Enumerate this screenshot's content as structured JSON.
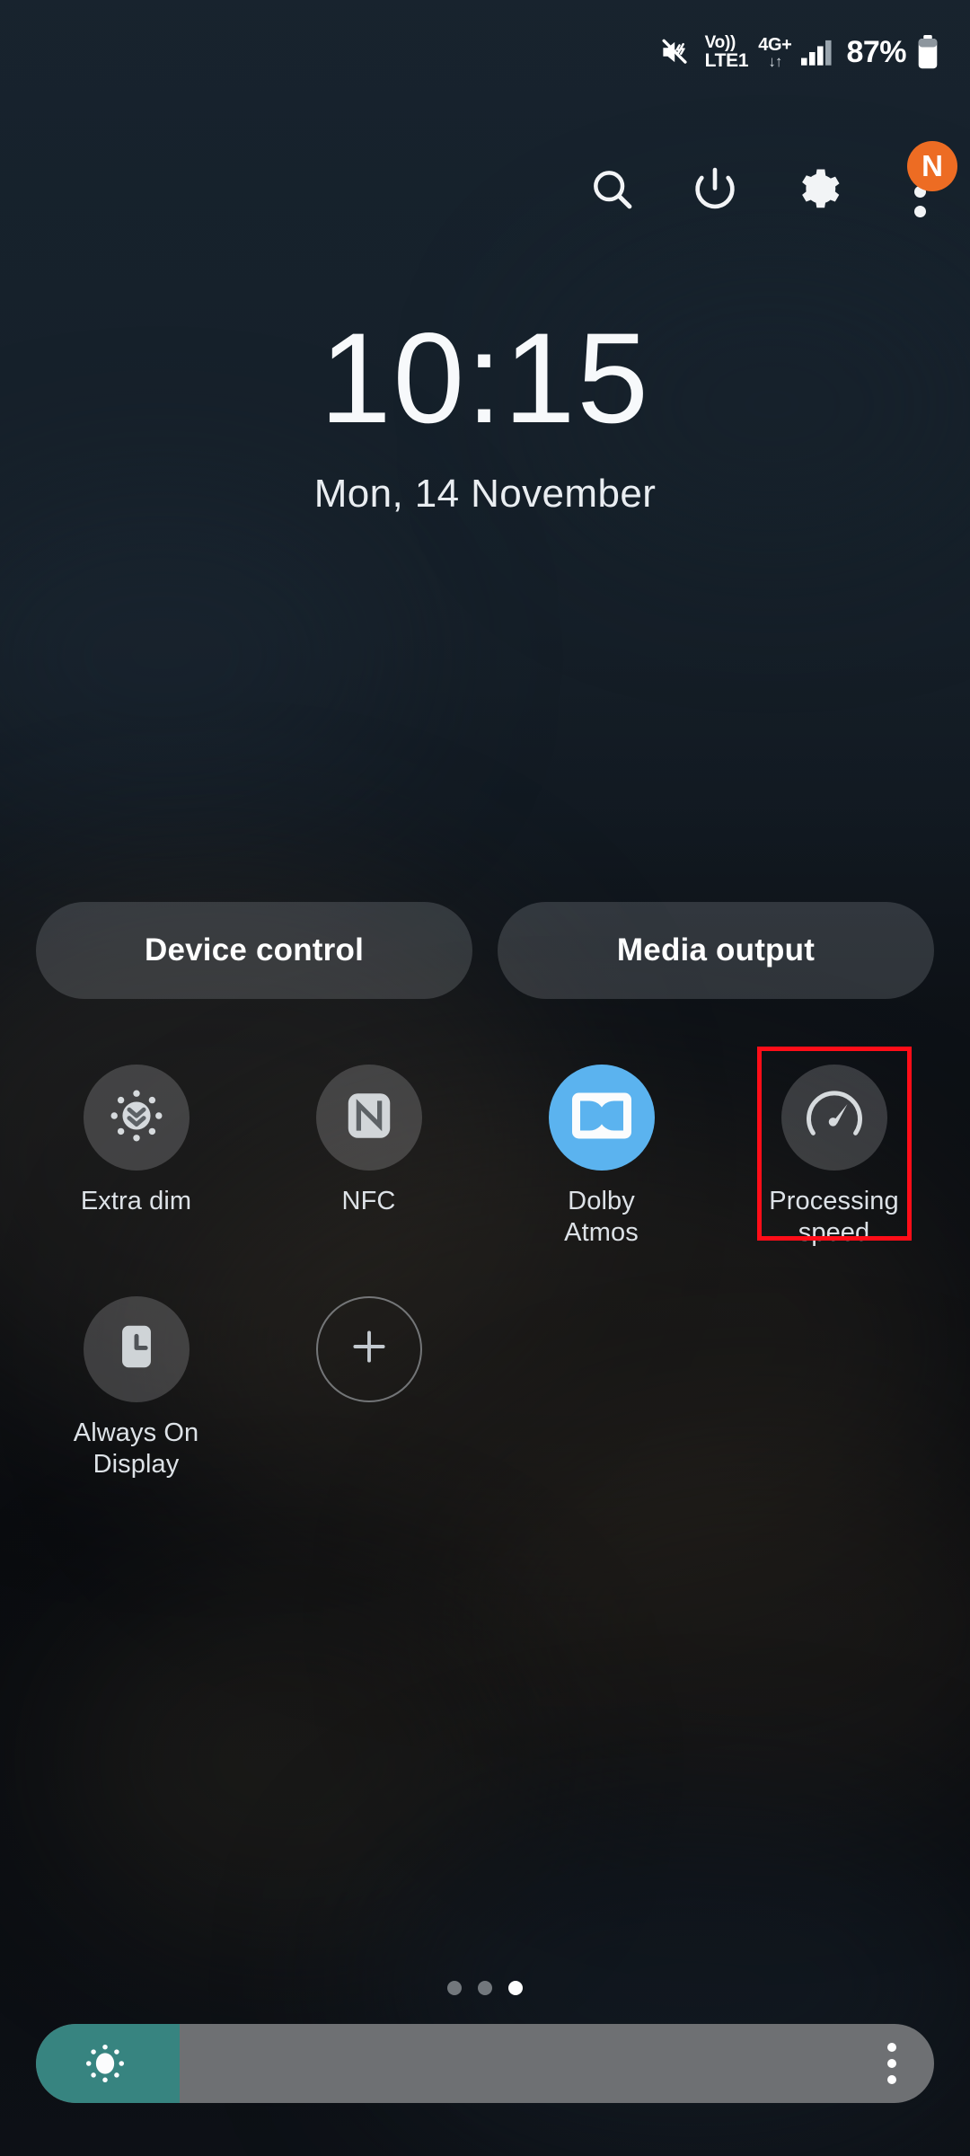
{
  "status_bar": {
    "mute_icon": "volume-mute-icon",
    "volte_line1": "Vo))",
    "volte_line2": "LTE1",
    "network_type": "4G+",
    "data_arrows": "↓↑",
    "signal_icon": "signal-bars-icon",
    "battery_percent": "87%",
    "battery_icon": "battery-icon"
  },
  "header": {
    "search_icon": "search-icon",
    "power_icon": "power-icon",
    "settings_icon": "gear-icon",
    "overflow_icon": "more-options-icon",
    "badge_label": "N",
    "badge_color": "#ED6C23"
  },
  "clock": {
    "time": "10:15",
    "date": "Mon, 14 November"
  },
  "pills": [
    {
      "label": "Device control",
      "name": "device-control-button"
    },
    {
      "label": "Media output",
      "name": "media-output-button"
    }
  ],
  "toggles": [
    {
      "label": "Extra dim",
      "icon": "extra-dim-icon",
      "state": "off"
    },
    {
      "label": "NFC",
      "icon": "nfc-icon",
      "state": "off"
    },
    {
      "label": "Dolby\nAtmos",
      "icon": "dolby-atmos-icon",
      "state": "on"
    },
    {
      "label": "Processing\nspeed",
      "icon": "processing-speed-icon",
      "state": "off",
      "highlighted": true
    },
    {
      "label": "Always On\nDisplay",
      "icon": "always-on-display-icon",
      "state": "off"
    },
    {
      "label": "",
      "icon": "add-icon",
      "state": "add"
    }
  ],
  "page_indicator": {
    "total": 3,
    "active": 3
  },
  "brightness": {
    "icon": "brightness-sun-icon",
    "value_percent": 16,
    "fill_color": "#378480",
    "track_color": "#6e7073",
    "menu_icon": "more-options-icon"
  },
  "highlight": {
    "color": "#FF0D18",
    "target": "Processing speed"
  }
}
